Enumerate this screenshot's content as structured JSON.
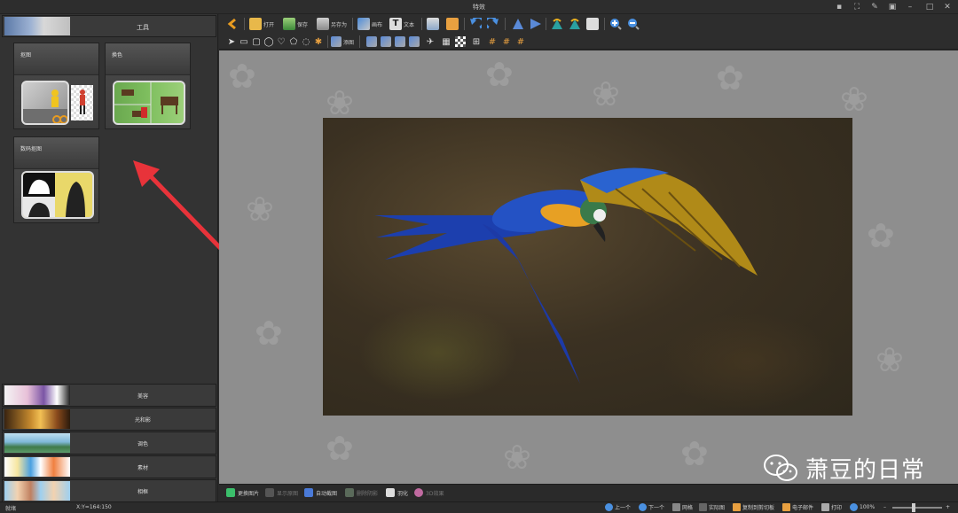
{
  "window": {
    "title": "特效"
  },
  "left_panel": {
    "header_label": "工具",
    "cards": [
      {
        "label": "抠图"
      },
      {
        "label": "换色"
      },
      {
        "label": "数码抠图"
      }
    ],
    "effects": [
      {
        "label": "美容"
      },
      {
        "label": "光和影"
      },
      {
        "label": "调色"
      },
      {
        "label": "素材"
      },
      {
        "label": "相框"
      }
    ]
  },
  "toolbar": {
    "open": "打开",
    "save": "保存",
    "save_as": "另存为",
    "layout": "画布",
    "text": "文本",
    "crop_label": "添图"
  },
  "bottom_toolbar": {
    "replace_image": "更换图片",
    "restore_original": "显示原图",
    "auto_size": "自动截图",
    "delete_background": "删除阴影",
    "feather": "羽化",
    "set_3d": "3D效果"
  },
  "status": {
    "ready": "就绪",
    "coords": "X:Y=164:150",
    "prev": "上一个",
    "next": "下一个",
    "grid": "网格",
    "actual_size": "实际图",
    "clip_frame": "复制到剪切板",
    "email": "电子邮件",
    "print": "打印",
    "zoom": "100%"
  },
  "watermark": {
    "text": "萧豆的日常"
  },
  "colors": {
    "accent_red": "#e8333a",
    "canvas_bg": "#8e8e8e"
  }
}
